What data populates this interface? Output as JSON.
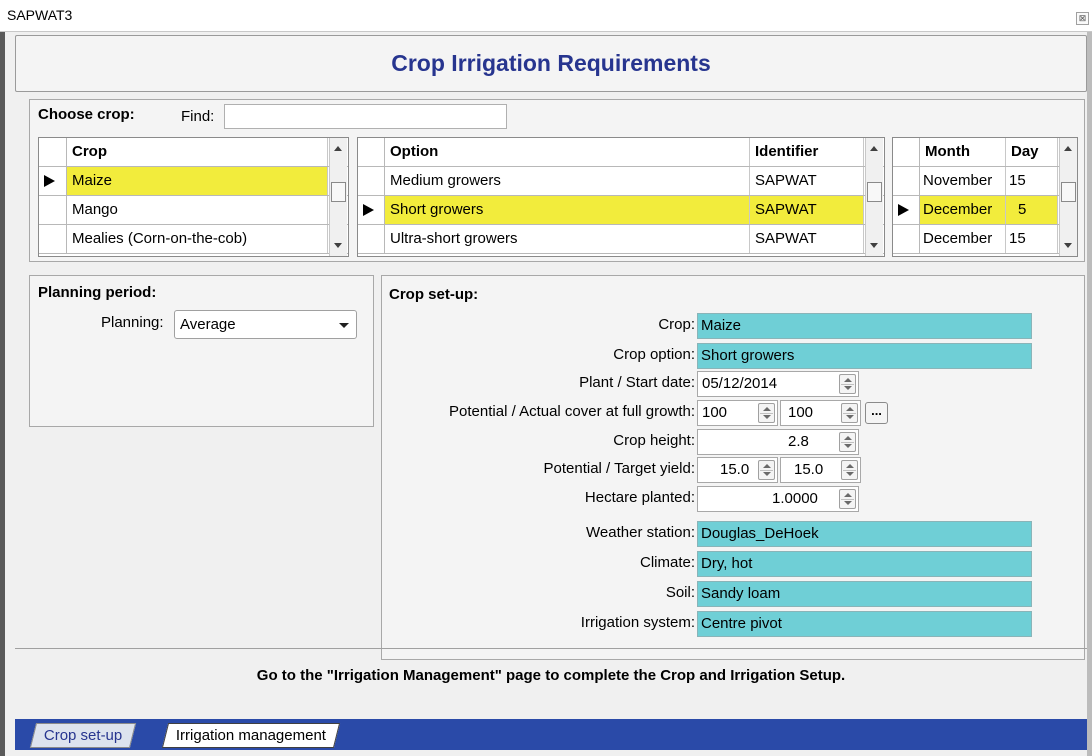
{
  "window": {
    "title": "SAPWAT3",
    "close_glyph": "⊠"
  },
  "header": {
    "title": "Crop Irrigation Requirements"
  },
  "choose_crop": {
    "label": "Choose crop:",
    "find_label": "Find:",
    "find_value": "",
    "crop_grid": {
      "header": "Crop",
      "rows": [
        "Maize",
        "Mango",
        "Mealies (Corn-on-the-cob)"
      ],
      "selected_index": 0
    },
    "option_grid": {
      "headers": [
        "Option",
        "Identifier"
      ],
      "rows": [
        [
          "Medium growers",
          "SAPWAT"
        ],
        [
          "Short growers",
          "SAPWAT"
        ],
        [
          "Ultra-short growers",
          "SAPWAT"
        ]
      ],
      "selected_index": 1
    },
    "date_grid": {
      "headers": [
        "Month",
        "Day"
      ],
      "rows": [
        [
          "November",
          "15"
        ],
        [
          "December",
          "5"
        ],
        [
          "December",
          "15"
        ]
      ],
      "selected_index": 1
    }
  },
  "planning": {
    "title": "Planning period:",
    "planning_label": "Planning:",
    "planning_value": "Average"
  },
  "crop_setup": {
    "title": "Crop set-up:",
    "crop_label": "Crop:",
    "crop_value": "Maize",
    "option_label": "Crop option:",
    "option_value": "Short growers",
    "plant_label": "Plant / Start date:",
    "plant_value": "05/12/2014",
    "cover_label": "Potential / Actual cover at full growth:",
    "cover_potential": "100",
    "cover_actual": "100",
    "ellipsis": "...",
    "height_label": "Crop height:",
    "height_value": "2.8",
    "yield_label": "Potential / Target yield:",
    "yield_potential": "15.0",
    "yield_target": "15.0",
    "hectare_label": "Hectare planted:",
    "hectare_value": "1.0000",
    "weather_label": "Weather station:",
    "weather_value": "Douglas_DeHoek",
    "climate_label": "Climate:",
    "climate_value": "Dry, hot",
    "soil_label": "Soil:",
    "soil_value": "Sandy loam",
    "irrigation_label": "Irrigation system:",
    "irrigation_value": "Centre pivot"
  },
  "footer": {
    "message": "Go to the \"Irrigation Management\" page to complete the Crop and Irrigation Setup."
  },
  "tabs": [
    {
      "label": "Crop set-up",
      "active": true
    },
    {
      "label": "Irrigation management",
      "active": false
    }
  ],
  "colors": {
    "title_blue": "#27358f",
    "selection_yellow": "#f2ec3c",
    "field_cyan": "#6fcfd6",
    "tabbar_blue": "#2a4aa8"
  }
}
